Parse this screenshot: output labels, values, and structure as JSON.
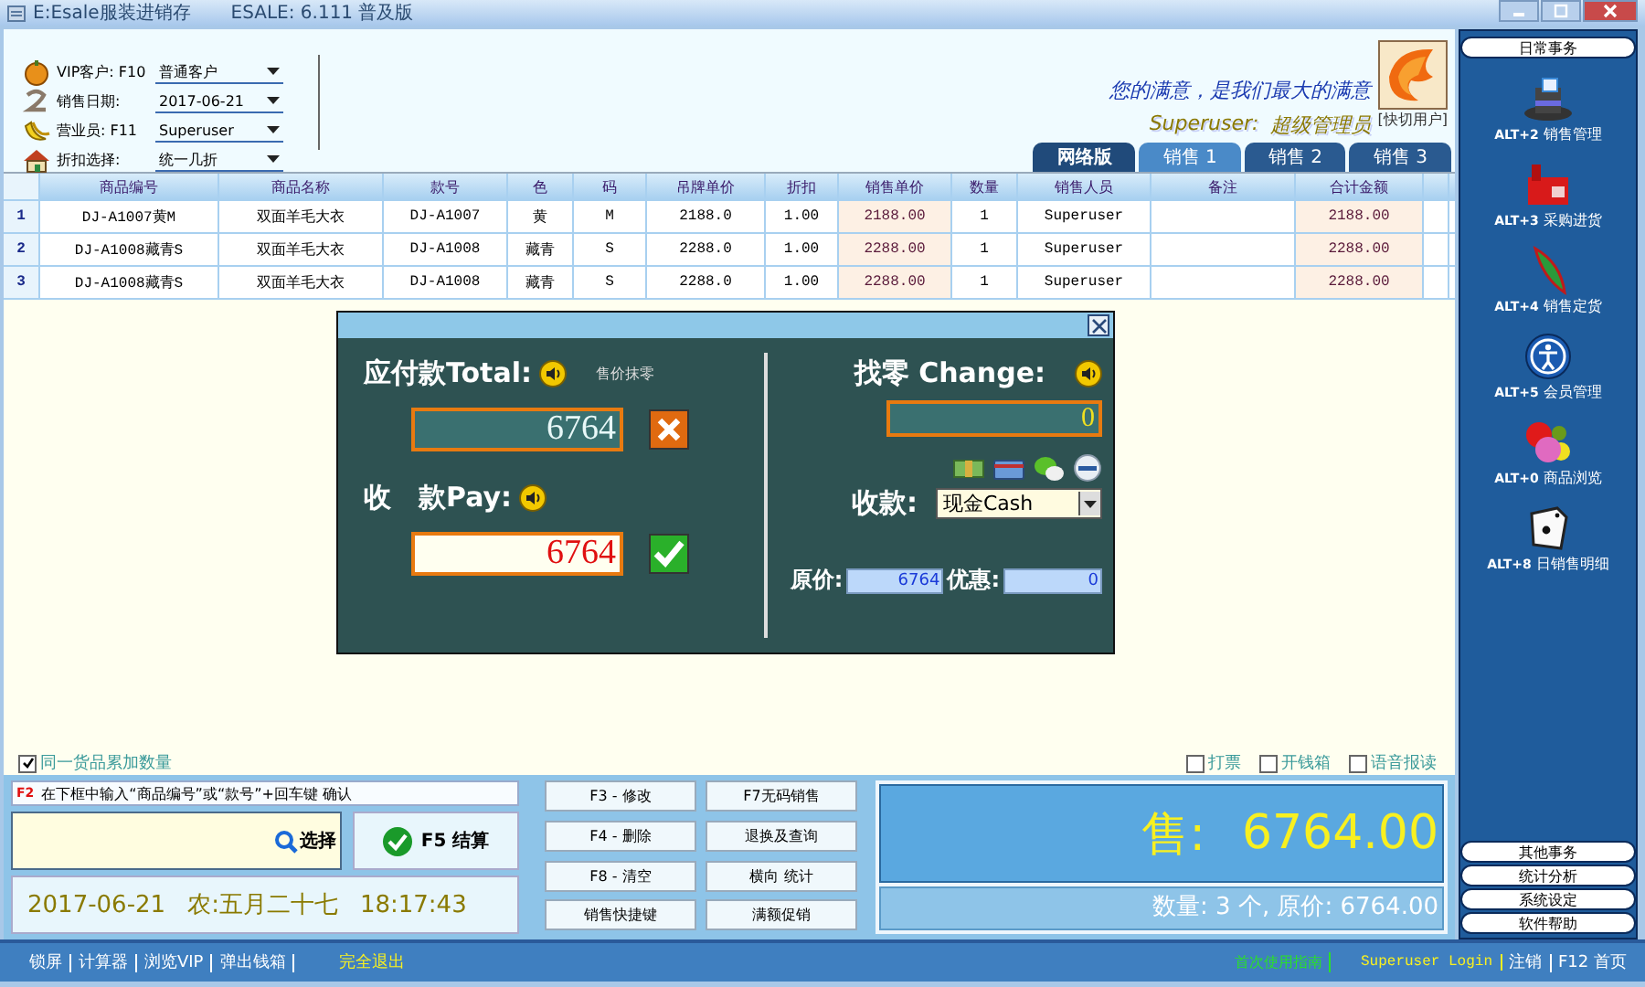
{
  "window": {
    "title": "E:Esale服装进销存",
    "version": "ESALE: 6.111 普及版"
  },
  "header_fields": [
    {
      "label": "VIP客户: F10",
      "value": "普通客户"
    },
    {
      "label": "销售日期:",
      "value": "2017-06-21"
    },
    {
      "label": "营业员: F11",
      "value": "Superuser"
    },
    {
      "label": "折扣选择:",
      "value": "统一几折"
    }
  ],
  "slogan": "您的满意，是我们最大的满意",
  "user": {
    "name": "Superuser:",
    "role": "超级管理员",
    "switch": "[快切用户]"
  },
  "tabs": [
    {
      "label": "网络版",
      "selected": false
    },
    {
      "label": "销售 1",
      "selected": true
    },
    {
      "label": "销售 2",
      "selected": false
    },
    {
      "label": "销售 3",
      "selected": false
    }
  ],
  "table": {
    "columns": [
      "商品编号",
      "商品名称",
      "款号",
      "色",
      "码",
      "吊牌单价",
      "折扣",
      "销售单价",
      "数量",
      "销售人员",
      "备注",
      "合计金额"
    ],
    "rows": [
      {
        "num": "1",
        "cells": [
          "DJ-A1007黄M",
          "双面羊毛大衣",
          "DJ-A1007",
          "黄",
          "M",
          "2188.0",
          "1.00",
          "2188.00",
          "1",
          "Superuser",
          "",
          "2188.00"
        ]
      },
      {
        "num": "2",
        "cells": [
          "DJ-A1008藏青S",
          "双面羊毛大衣",
          "DJ-A1008",
          "藏青",
          "S",
          "2288.0",
          "1.00",
          "2288.00",
          "1",
          "Superuser",
          "",
          "2288.00"
        ]
      },
      {
        "num": "3",
        "cells": [
          "DJ-A1008藏青S",
          "双面羊毛大衣",
          "DJ-A1008",
          "藏青",
          "S",
          "2288.0",
          "1.00",
          "2288.00",
          "1",
          "Superuser",
          "",
          "2288.00"
        ]
      }
    ]
  },
  "payment_dialog": {
    "total_label": "应付款Total:",
    "erase_label": "售价抹零",
    "total": "6764",
    "pay_label": "收　款Pay:",
    "pay": "6764",
    "change_label": "找零 Change:",
    "change": "0",
    "method_label": "收款:",
    "method": "现金Cash",
    "original_label": "原价:",
    "original": "6764",
    "discount_label": "优惠:",
    "discount": "0"
  },
  "accumulate_option": {
    "label": "同一货品累加数量",
    "checked": true
  },
  "print_options": [
    {
      "label": "打票",
      "checked": false
    },
    {
      "label": "开钱箱",
      "checked": false
    },
    {
      "label": "语音报读",
      "checked": false
    }
  ],
  "hint": {
    "key": "F2",
    "text": "在下框中输入“商品编号”或“款号”+回车键 确认"
  },
  "search_button": "选择",
  "settle_button": "F5 结算",
  "clock": {
    "date": "2017-06-21",
    "lunar": "农:五月二十七",
    "time": "18:17:43"
  },
  "function_buttons": [
    "F3 - 修改",
    "F7无码销售",
    "F4 - 删除",
    "退换及查询",
    "F8 - 清空",
    "横向 统计",
    "销售快捷键",
    "满额促销"
  ],
  "sale_display": {
    "label": "售:",
    "amount": "6764.00",
    "summary": "数量: 3 个, 原价: 6764.00"
  },
  "sidebar": {
    "header": "日常事务",
    "items": [
      {
        "shortcut": "ALT+2",
        "label": "销售管理"
      },
      {
        "shortcut": "ALT+3",
        "label": "采购进货"
      },
      {
        "shortcut": "ALT+4",
        "label": "销售定货"
      },
      {
        "shortcut": "ALT+5",
        "label": "会员管理"
      },
      {
        "shortcut": "ALT+0",
        "label": "商品浏览"
      },
      {
        "shortcut": "ALT+8",
        "label": "日销售明细"
      }
    ],
    "bottom_buttons": [
      "其他事务",
      "统计分析",
      "系统设定",
      "软件帮助"
    ]
  },
  "status_bar": {
    "left_links": [
      "锁屏",
      "计算器",
      "浏览VIP",
      "弹出钱箱"
    ],
    "exit": "完全退出",
    "guide": "首次使用指南",
    "login": "Superuser Login",
    "logout": "注销",
    "home": "F12 首页"
  }
}
